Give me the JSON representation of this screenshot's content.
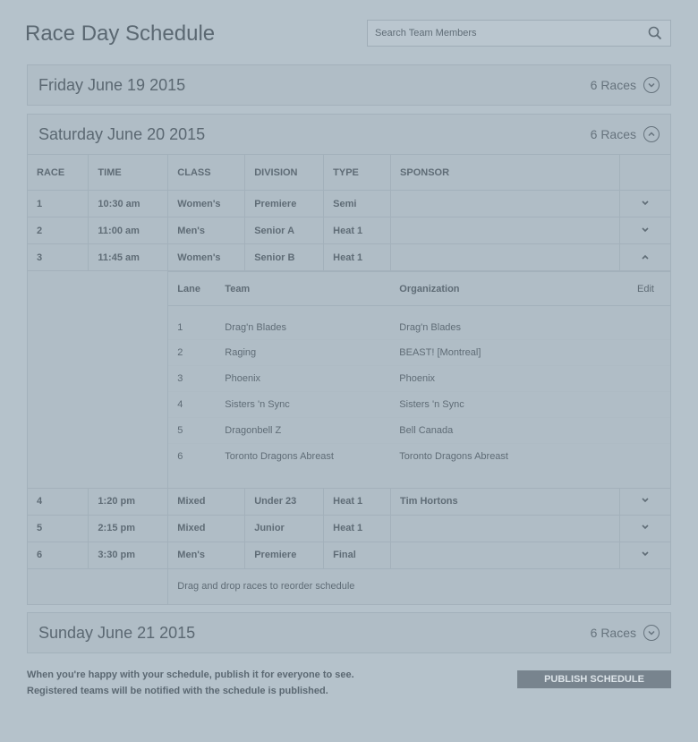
{
  "page_title": "Race Day Schedule",
  "search": {
    "placeholder": "Search Team Members"
  },
  "days": [
    {
      "title": "Friday June 19 2015",
      "count": "6 Races",
      "expanded": false
    },
    {
      "title": "Saturday June 20 2015",
      "count": "6 Races",
      "expanded": true
    },
    {
      "title": "Sunday June 21 2015",
      "count": "6 Races",
      "expanded": false
    }
  ],
  "schedule": {
    "headers": [
      "RACE",
      "TIME",
      "CLASS",
      "DIVISION",
      "TYPE",
      "SPONSOR"
    ],
    "races": [
      {
        "race": "1",
        "time": "10:30 am",
        "class": "Women's",
        "division": "Premiere",
        "type": "Semi",
        "sponsor": ""
      },
      {
        "race": "2",
        "time": "11:00 am",
        "class": "Men's",
        "division": "Senior A",
        "type": "Heat 1",
        "sponsor": ""
      },
      {
        "race": "3",
        "time": "11:45 am",
        "class": "Women's",
        "division": "Senior B",
        "type": "Heat 1",
        "sponsor": ""
      },
      {
        "race": "4",
        "time": "1:20 pm",
        "class": "Mixed",
        "division": "Under 23",
        "type": "Heat 1",
        "sponsor": "Tim Hortons"
      },
      {
        "race": "5",
        "time": "2:15 pm",
        "class": "Mixed",
        "division": "Junior",
        "type": "Heat 1",
        "sponsor": ""
      },
      {
        "race": "6",
        "time": "3:30 pm",
        "class": "Men's",
        "division": "Premiere",
        "type": "Final",
        "sponsor": ""
      }
    ],
    "lane_headers": {
      "lane": "Lane",
      "team": "Team",
      "organization": "Organization",
      "edit": "Edit"
    },
    "lanes": [
      {
        "lane": "1",
        "team": "Drag'n Blades",
        "organization": "Drag'n Blades"
      },
      {
        "lane": "2",
        "team": "Raging",
        "organization": "BEAST! [Montreal]"
      },
      {
        "lane": "3",
        "team": "Phoenix",
        "organization": "Phoenix"
      },
      {
        "lane": "4",
        "team": "Sisters 'n Sync",
        "organization": "Sisters 'n Sync"
      },
      {
        "lane": "5",
        "team": "Dragonbell Z",
        "organization": "Bell Canada"
      },
      {
        "lane": "6",
        "team": "Toronto Dragons Abreast",
        "organization": "Toronto Dragons Abreast"
      }
    ],
    "reorder_hint": "Drag and drop races to reorder schedule"
  },
  "footer": {
    "line1": "When you're happy with your schedule, publish it for everyone to see.",
    "line2": "Registered teams will be notified with the schedule is published.",
    "publish_label": "PUBLISH SCHEDULE"
  },
  "icons": {
    "search": "search-icon",
    "expand": "chevron-down-icon",
    "collapse": "chevron-up-icon"
  }
}
